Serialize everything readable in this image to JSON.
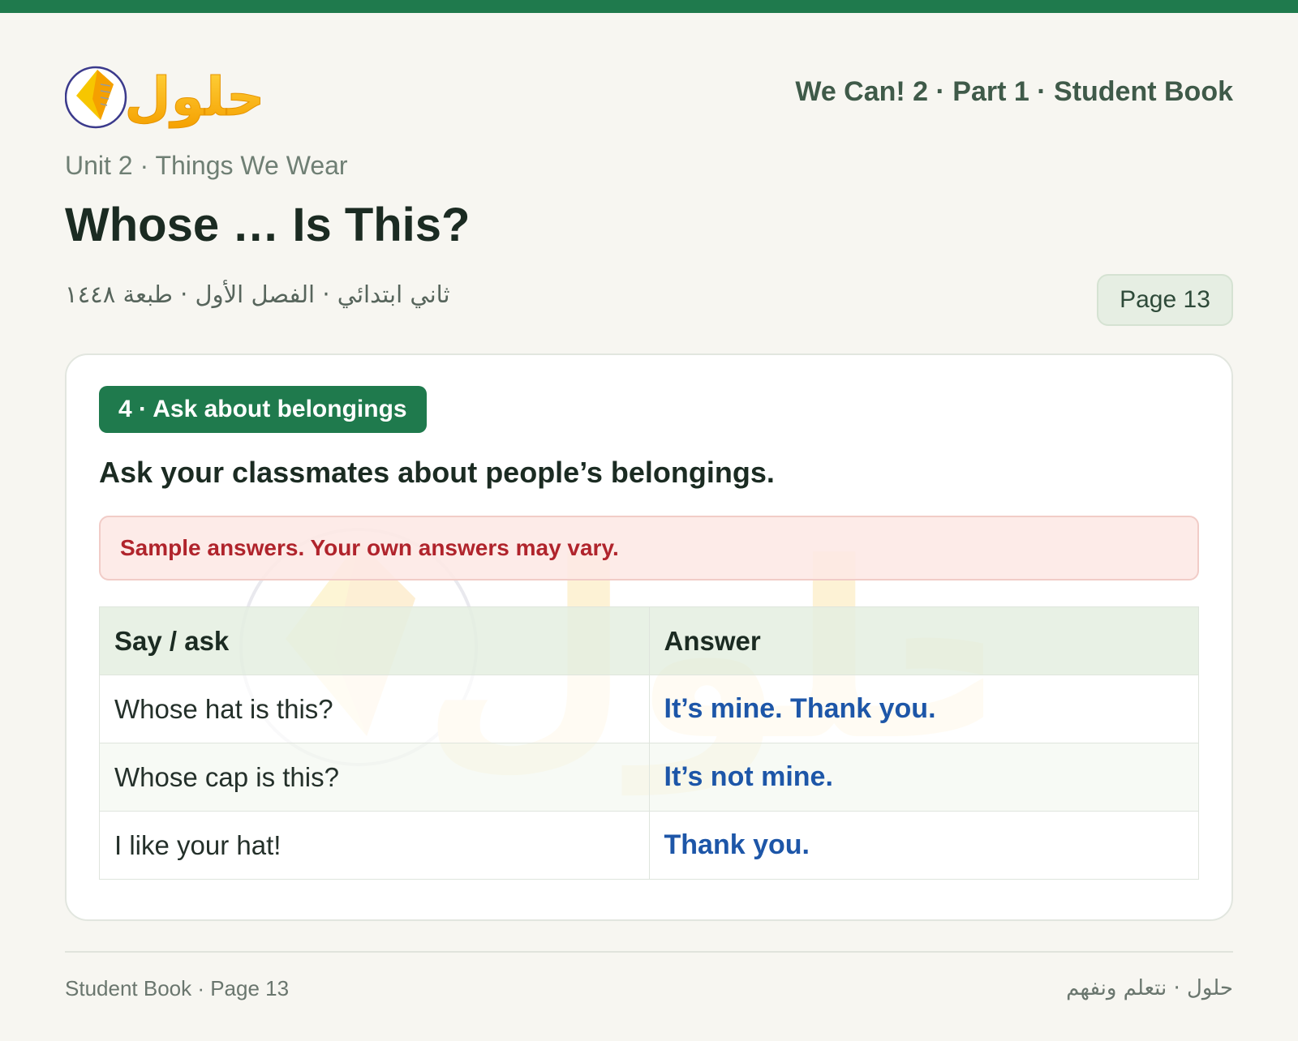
{
  "brand": {
    "logo_text": "حلول"
  },
  "header": {
    "book_title": "We Can! 2 · Part 1 · Student Book",
    "unit_line": "Unit 2 · Things We Wear",
    "page_heading": "Whose … Is This?",
    "arabic_subtitle": "ثاني ابتدائي · الفصل الأول · طبعة ١٤٤٨",
    "page_badge": "Page 13"
  },
  "card": {
    "section_label": "4 · Ask about belongings",
    "instruction": "Ask your classmates about people’s belongings.",
    "note": "Sample answers. Your own answers may vary.",
    "table": {
      "headers": [
        "Say / ask",
        "Answer"
      ],
      "rows": [
        {
          "ask": "Whose hat is this?",
          "answer": "It’s mine. Thank you."
        },
        {
          "ask": "Whose cap is this?",
          "answer": "It’s not mine."
        },
        {
          "ask": "I like your hat!",
          "answer": "Thank you."
        }
      ]
    }
  },
  "footer": {
    "left": "Student Book · Page 13",
    "right": "حلول · نتعلم ونفهم"
  },
  "colors": {
    "accent_green": "#1f7a4d",
    "answer_blue": "#1d56a8",
    "note_red": "#b0242c",
    "logo_orange": "#f5a623",
    "logo_yellow": "#f7c600",
    "logo_ring": "#3b3a8c"
  }
}
